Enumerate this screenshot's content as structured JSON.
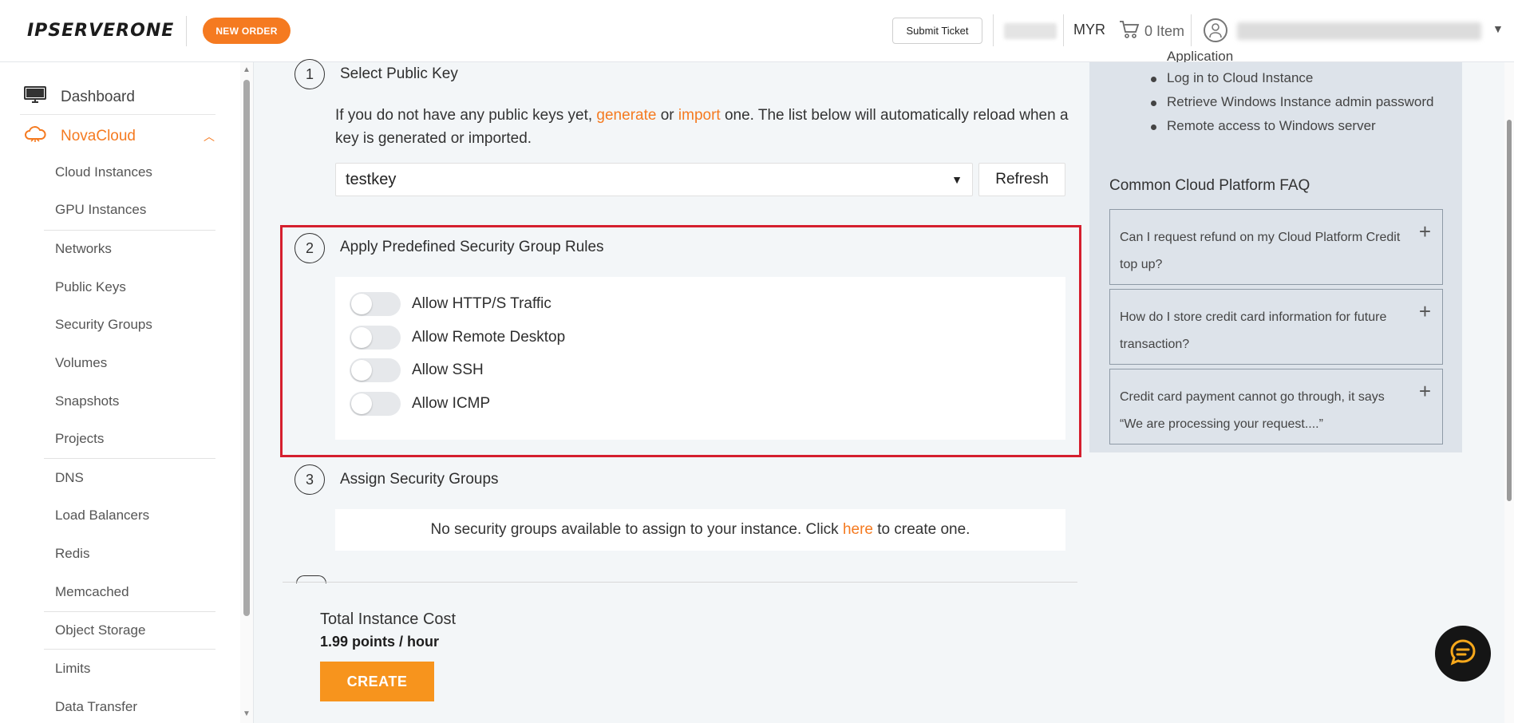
{
  "header": {
    "logo": "IPSERVERONE",
    "new_order": "NEW ORDER",
    "submit_ticket": "Submit Ticket",
    "currency": "MYR",
    "cart": "0 Item"
  },
  "sidebar": {
    "dashboard": "Dashboard",
    "novacloud": "NovaCloud",
    "items": [
      "Cloud Instances",
      "GPU Instances",
      "Networks",
      "Public Keys",
      "Security Groups",
      "Volumes",
      "Snapshots",
      "Projects",
      "DNS",
      "Load Balancers",
      "Redis",
      "Memcached",
      "Object Storage",
      "Limits",
      "Data Transfer"
    ]
  },
  "steps": {
    "step1": {
      "number": "1",
      "title": "Select Public Key",
      "text_before": "If you do not have any public keys yet, ",
      "link_generate": "generate",
      "text_or": " or ",
      "link_import": "import",
      "text_after": " one. The list below will automatically reload when a key is generated or imported.",
      "selected_key": "testkey",
      "refresh": "Refresh"
    },
    "step2": {
      "number": "2",
      "title": "Apply Predefined Security Group Rules",
      "rules": [
        "Allow HTTP/S Traffic",
        "Allow Remote Desktop",
        "Allow SSH",
        "Allow ICMP"
      ]
    },
    "step3": {
      "number": "3",
      "title": "Assign Security Groups",
      "text_before": "No security groups available to assign to your instance. Click ",
      "link": "here",
      "text_after": " to create one."
    }
  },
  "footer": {
    "total_label": "Total Instance Cost",
    "total_value": "1.99 points / hour",
    "create": "CREATE"
  },
  "right_panel": {
    "peek_text": "Application",
    "help_items": [
      "Log in to Cloud Instance",
      "Retrieve Windows Instance admin password",
      "Remote access to Windows server"
    ],
    "faq_title": "Common Cloud Platform FAQ",
    "faqs": [
      "Can I request refund on my Cloud Platform Credit top up?",
      "How do I store credit card information for future transaction?",
      "Credit card payment cannot go through, it says “We are processing your request....”"
    ]
  },
  "colors": {
    "accent": "#f57a20",
    "highlight": "#d51f2e",
    "create_button": "#f7941d",
    "panel": "#dde3ea"
  }
}
